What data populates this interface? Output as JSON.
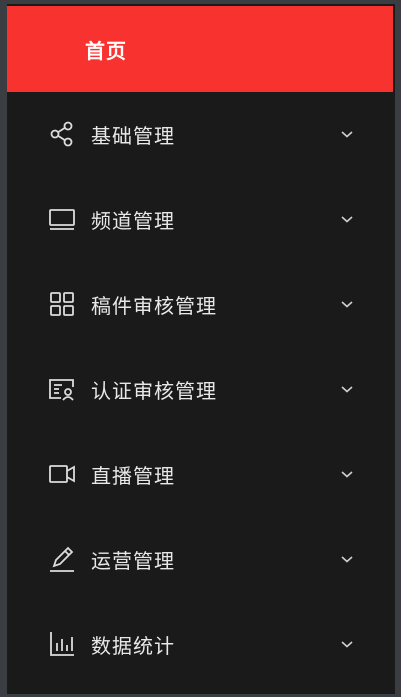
{
  "colors": {
    "active_bg": "#f7322f",
    "sidebar_bg": "#1a1a1a",
    "text": "#e8e8e8"
  },
  "home": {
    "label": "首页"
  },
  "menu": [
    {
      "label": "基础管理",
      "icon": "share-nodes-icon"
    },
    {
      "label": "频道管理",
      "icon": "monitor-icon"
    },
    {
      "label": "稿件审核管理",
      "icon": "grid-icon"
    },
    {
      "label": "认证审核管理",
      "icon": "id-card-icon"
    },
    {
      "label": "直播管理",
      "icon": "video-camera-icon"
    },
    {
      "label": "运营管理",
      "icon": "pen-icon"
    },
    {
      "label": "数据统计",
      "icon": "bar-chart-icon"
    }
  ]
}
